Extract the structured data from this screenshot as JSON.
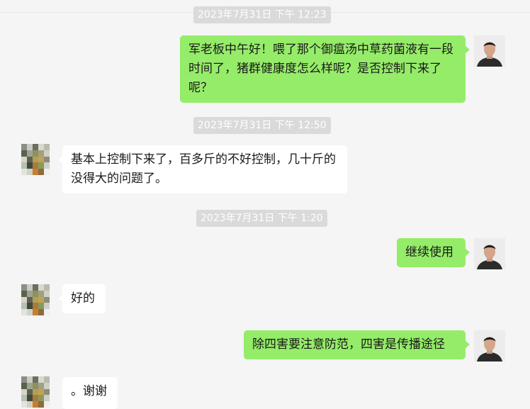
{
  "chat": {
    "messages": [
      {
        "type": "time",
        "text": "2023年7月31日 下午 12:23"
      },
      {
        "type": "msg",
        "from": "me",
        "text": "军老板中午好！喂了那个御瘟汤中草药菌液有一段时间了，猪群健康度怎么样呢？是否控制下来了呢？"
      },
      {
        "type": "time",
        "text": "2023年7月31日 下午 12:50"
      },
      {
        "type": "msg",
        "from": "other",
        "text": "基本上控制下来了，百多斤的不好控制，几十斤的没得大的问题了。"
      },
      {
        "type": "time",
        "text": "2023年7月31日 下午 1:20"
      },
      {
        "type": "msg",
        "from": "me",
        "text": "继续使用"
      },
      {
        "type": "msg",
        "from": "other",
        "text": "好的"
      },
      {
        "type": "msg",
        "from": "me",
        "text": "除四害要注意防范，四害是传播途径"
      },
      {
        "type": "msg",
        "from": "other",
        "text": "。谢谢"
      }
    ]
  },
  "colors": {
    "self_bubble": "#95ec69",
    "other_bubble": "#ffffff",
    "background": "#f5f5f5",
    "timestamp_bg": "#dadada"
  }
}
